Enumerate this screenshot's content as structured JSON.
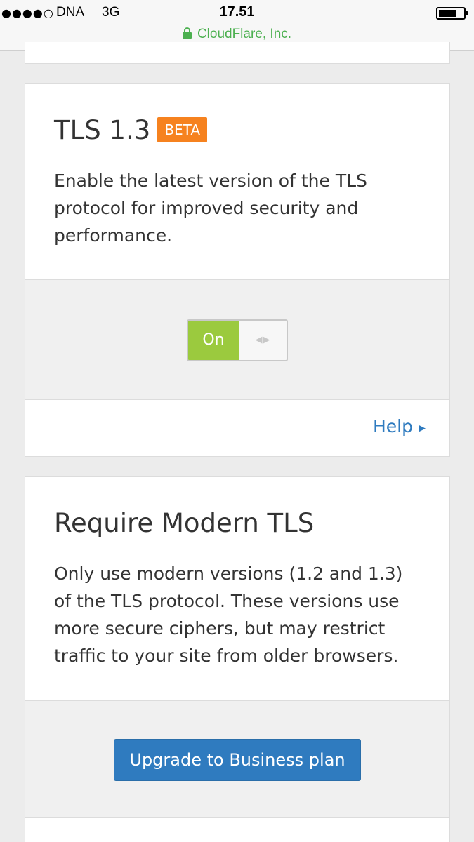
{
  "status_bar": {
    "signal": "●●●●○",
    "carrier": "DNA",
    "network": "3G",
    "time": "17.51",
    "url": "CloudFlare, Inc."
  },
  "tls13": {
    "title": "TLS 1.3",
    "badge": "BETA",
    "description": "Enable the latest version of the TLS protocol for improved security and performance.",
    "toggle_label": "On",
    "toggle_handle": "◀▶",
    "help_label": "Help",
    "help_caret": "▶"
  },
  "modern_tls": {
    "title": "Require Modern TLS",
    "description": "Only use modern versions (1.2 and 1.3) of the TLS protocol. These versions use more secure ciphers, but may restrict traffic to your site from older browsers.",
    "button_label": "Upgrade to Business plan"
  },
  "colors": {
    "badge": "#f6821f",
    "toggle_on": "#9bca3e",
    "link": "#2f7bbf",
    "secure_green": "#4cb050"
  }
}
